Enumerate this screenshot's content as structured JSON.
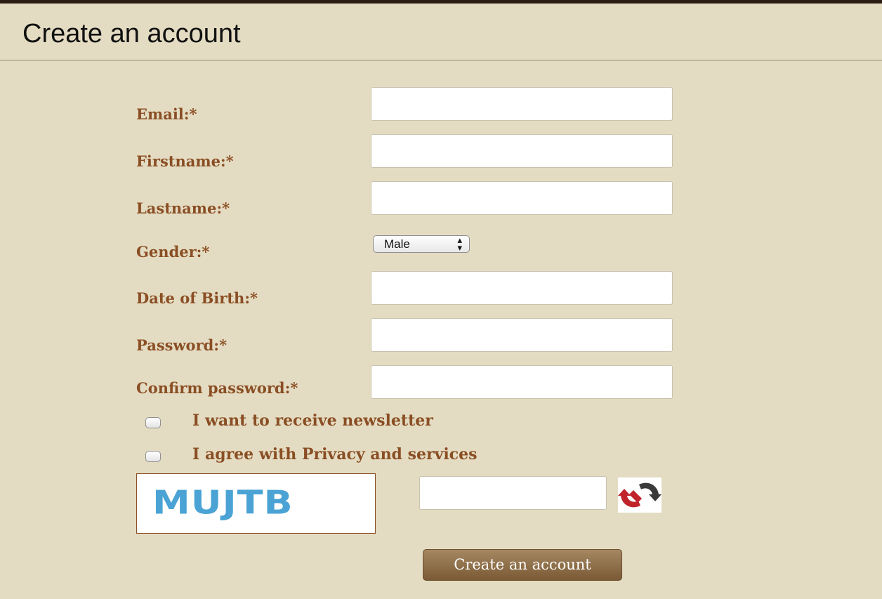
{
  "page": {
    "title": "Create an account"
  },
  "form": {
    "fields": [
      {
        "label": "Email:*",
        "value": ""
      },
      {
        "label": "Firstname:*",
        "value": ""
      },
      {
        "label": "Lastname:*",
        "value": ""
      },
      {
        "label": "Gender:*",
        "value": "Male"
      },
      {
        "label": "Date of Birth:*",
        "value": ""
      },
      {
        "label": "Password:*",
        "value": ""
      },
      {
        "label": "Confirm password:*",
        "value": ""
      }
    ],
    "gender_options_visible": [
      "Male"
    ],
    "checkboxes": [
      {
        "label": "I want to receive newsletter",
        "checked": false
      },
      {
        "label": "I agree with Privacy and services",
        "checked": false
      }
    ],
    "captcha": {
      "code": "MUJTB",
      "input_value": ""
    },
    "refresh_icon": "refresh-captcha-icon",
    "submit_label": "Create an account"
  },
  "colors": {
    "background": "#e4dcc2",
    "label": "#8a4e24",
    "captcha_text": "#4aa3d4",
    "button": "#8b6b45"
  }
}
